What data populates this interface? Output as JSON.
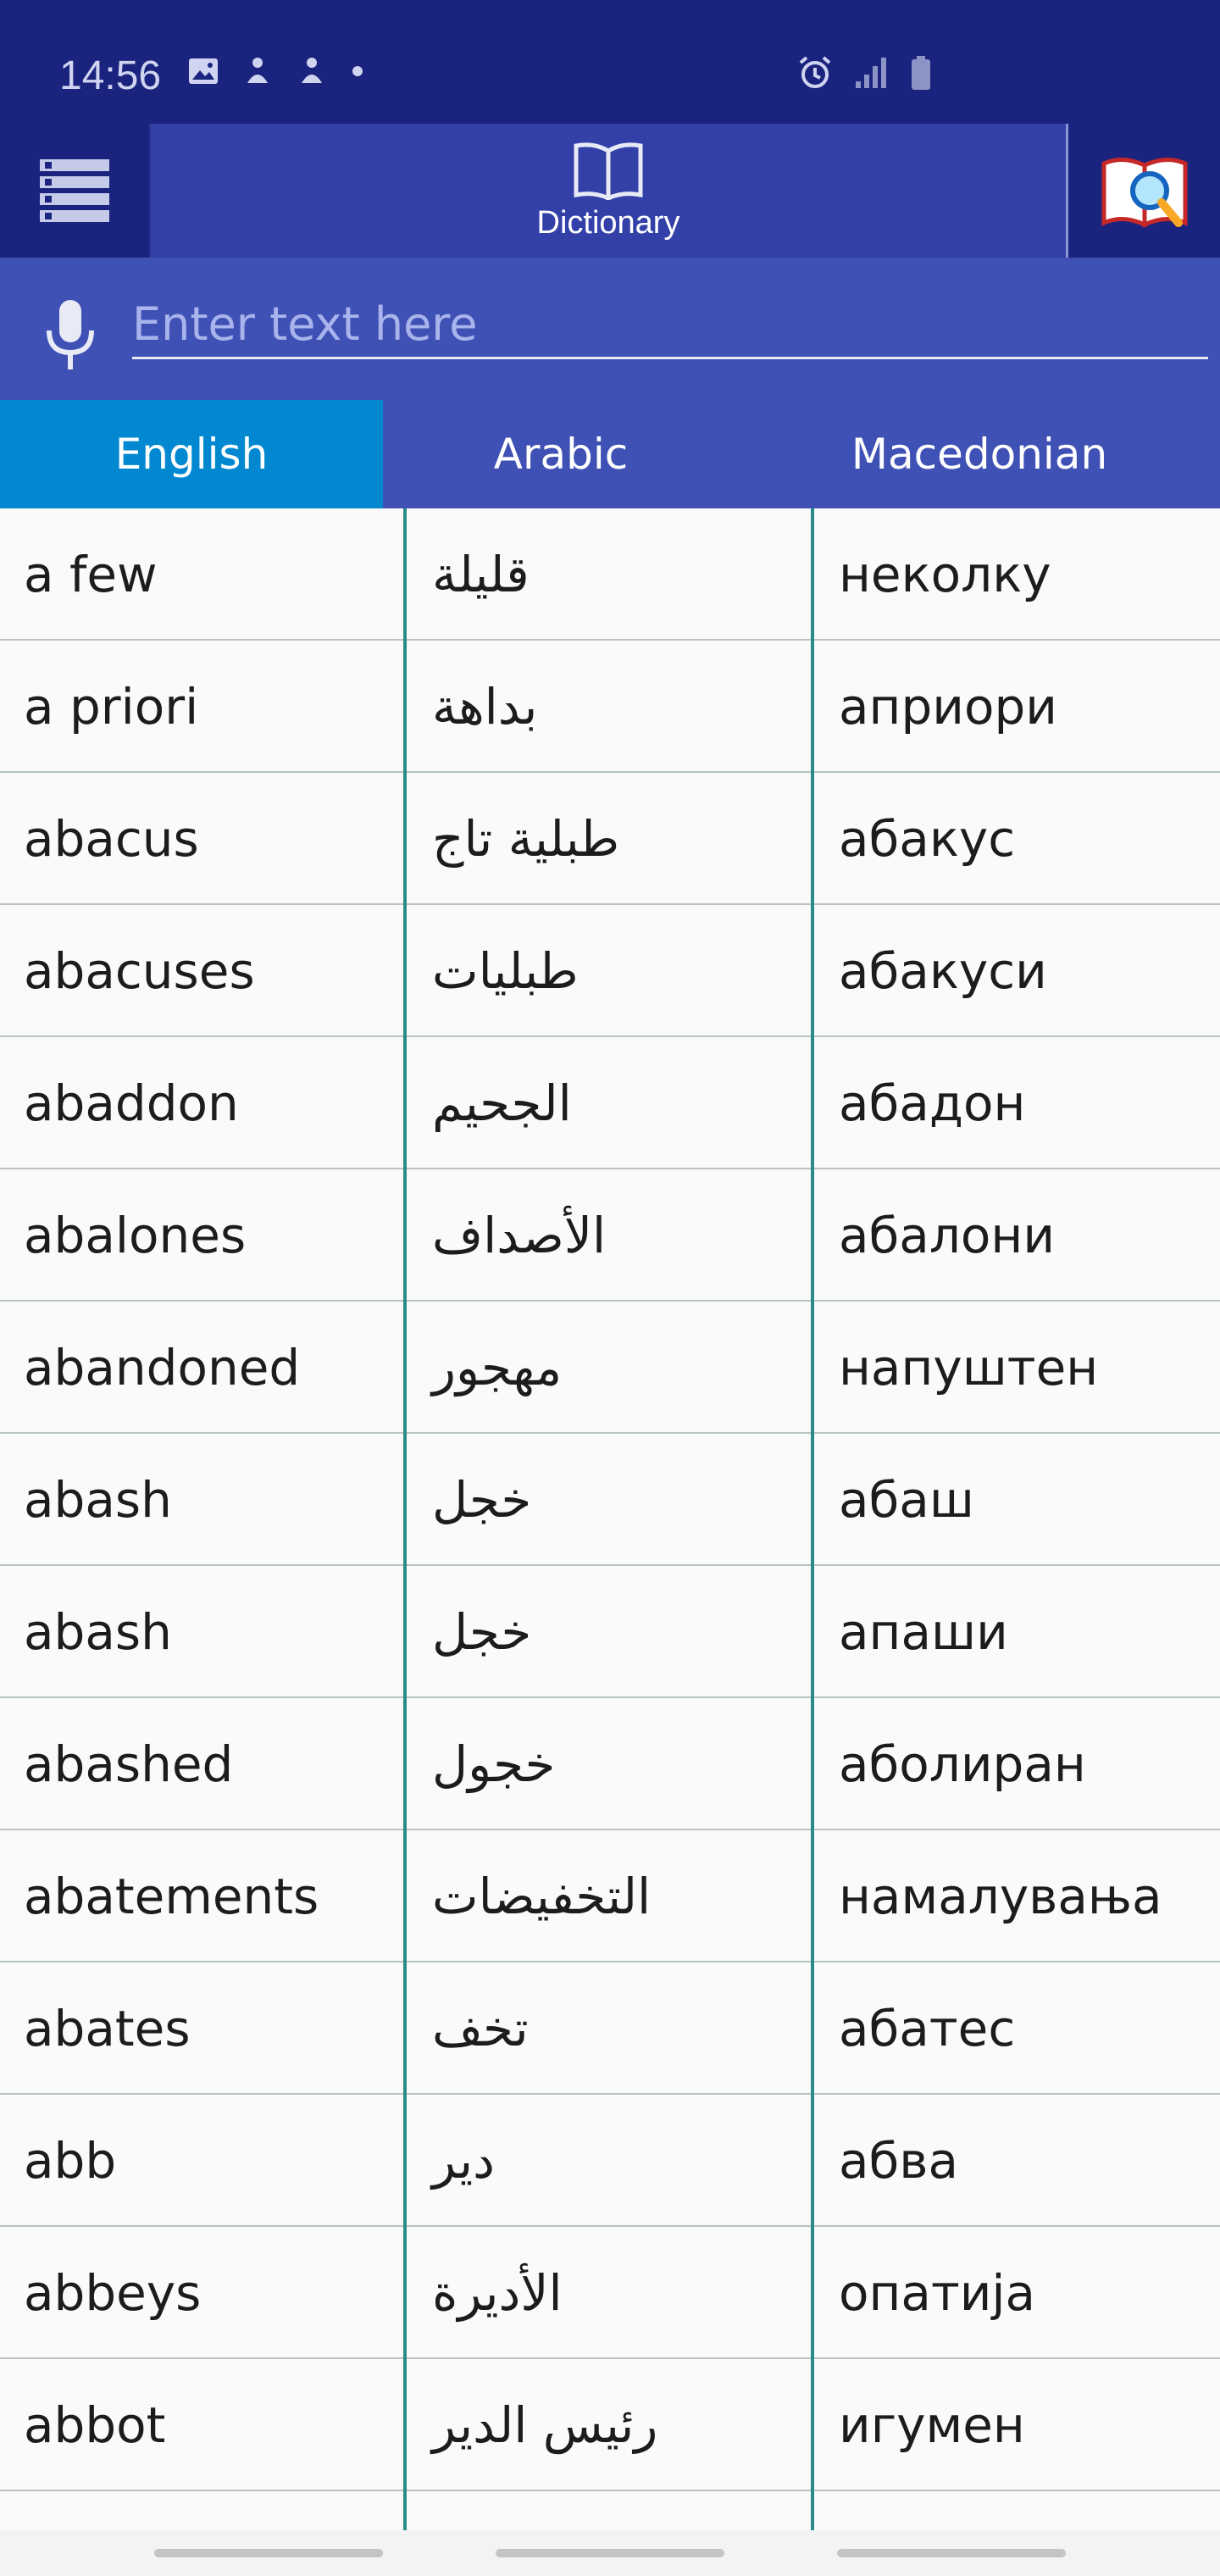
{
  "status_bar": {
    "time": "14:56",
    "left_icons": [
      "image-icon",
      "app-icon",
      "app-icon",
      "dot-icon"
    ],
    "right_icons": [
      "alarm-icon",
      "signal-icon",
      "battery-icon"
    ]
  },
  "toolbar": {
    "menu_icon": "menu-icon",
    "title": "Dictionary",
    "title_icon": "book-icon",
    "search_icon": "dictionary-search-icon"
  },
  "search": {
    "placeholder": "Enter text here",
    "value": ""
  },
  "languages": {
    "tabs": [
      "English",
      "Arabic",
      "Macedonian"
    ],
    "active": "English"
  },
  "entries": [
    [
      "a few",
      "قليلة",
      "неколку"
    ],
    [
      "a priori",
      "بداهة",
      "априори"
    ],
    [
      "abacus",
      "طبلية تاج",
      "абакус"
    ],
    [
      "abacuses",
      "طبليات",
      "абакуси"
    ],
    [
      "abaddon",
      "الجحيم",
      "абадон"
    ],
    [
      "abalones",
      "الأصداف",
      "абалони"
    ],
    [
      "abandoned",
      "مهجور",
      "напуштен"
    ],
    [
      "abash",
      "خجل",
      "абаш"
    ],
    [
      "abash",
      "خجل",
      "апаши"
    ],
    [
      "abashed",
      "خجول",
      "аболиран"
    ],
    [
      "abatements",
      "التخفيضات",
      "намалувања"
    ],
    [
      "abates",
      "تخف",
      "абатес"
    ],
    [
      "abb",
      "دير",
      "абва"
    ],
    [
      "abbeys",
      "الأديرة",
      "опатија"
    ],
    [
      "abbot",
      "رئيس الدير",
      "игумен"
    ]
  ],
  "colors": {
    "primary": "#1a237e",
    "accent": "#3f51b5",
    "active_tab": "#0288d1",
    "divider": "#2a8c86"
  }
}
